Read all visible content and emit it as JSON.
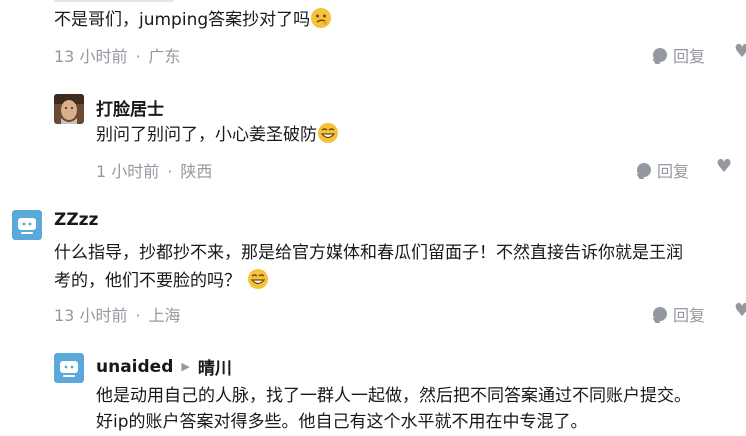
{
  "comments": [
    {
      "text": "不是哥们，jumping答案抄对了吗",
      "time": "13 小时前",
      "location": "广东",
      "reply_label": "回复"
    },
    {
      "user": "打脸居士",
      "text": "别问了别问了，小心姜圣破防",
      "time": "1 小时前",
      "location": "陕西",
      "reply_label": "回复"
    },
    {
      "user": "ZZzz",
      "text_line1": "什么指导，抄都抄不来，那是给官方媒体和春瓜们留面子！不然直接告诉你就是王润",
      "text_line2": "考的，他们不要脸的吗？",
      "time": "13 小时前",
      "location": "上海",
      "reply_label": "回复"
    },
    {
      "user": "unaided",
      "reply_to": "晴川",
      "text_line1": "他是动用自己的人脉，找了一群人一起做，然后把不同答案通过不同账户提交。",
      "text_line2": "好ip的账户答案对得多些。他自己有这个水平就不用在中专混了。"
    }
  ],
  "colors": {
    "meta": "#9499a0",
    "text": "#18191c",
    "avatar_blue": "#5aa9d8"
  },
  "icons": [
    "reply-bubble-icon",
    "like-heart-icon",
    "smirk-emoji",
    "grin-emoji",
    "avatar-tv-icon",
    "avatar-photo"
  ]
}
